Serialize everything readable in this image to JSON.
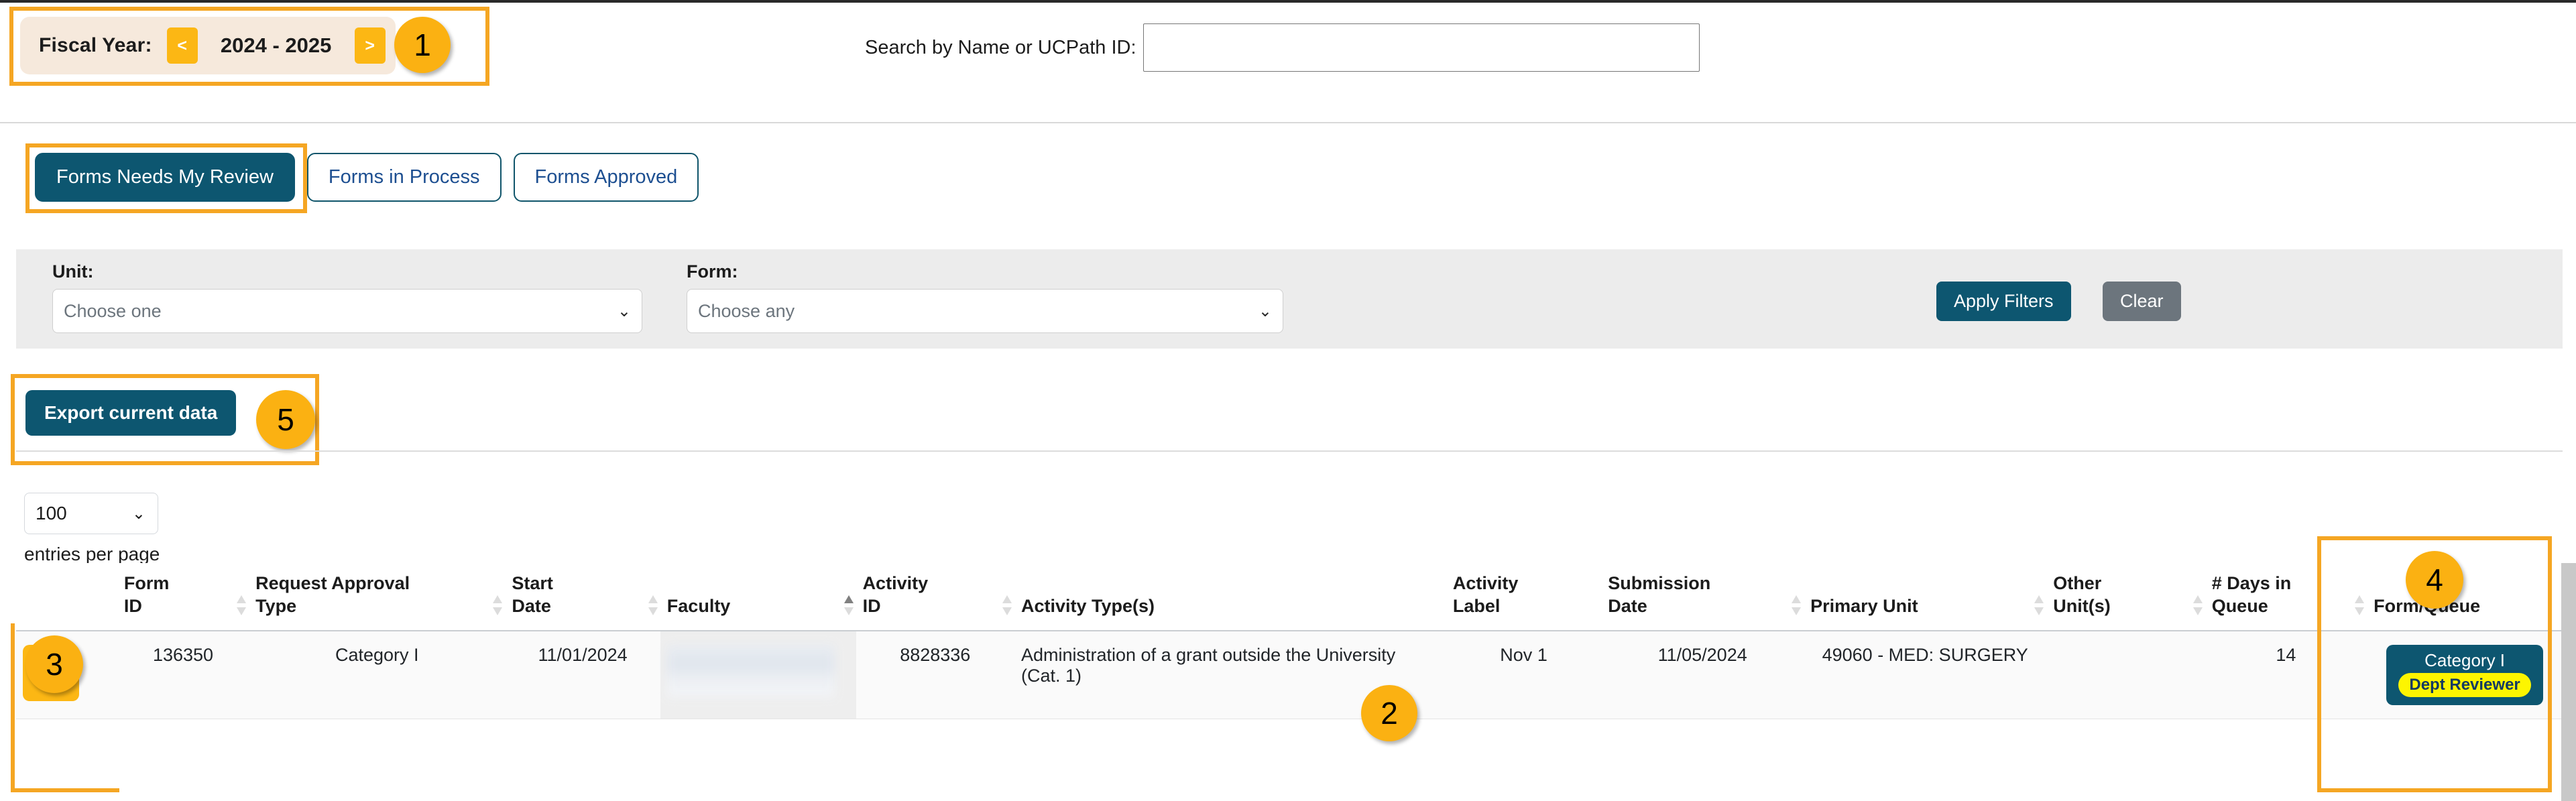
{
  "header": {
    "fiscal_year_label": "Fiscal Year:",
    "fiscal_year_prev": "<",
    "fiscal_year_value": "2024 - 2025",
    "fiscal_year_next": ">",
    "search_label": "Search by Name or UCPath ID:",
    "search_value": "",
    "search_placeholder": ""
  },
  "tabs": [
    {
      "label": "Forms Needs My Review",
      "active": true
    },
    {
      "label": "Forms in Process",
      "active": false
    },
    {
      "label": "Forms Approved",
      "active": false
    }
  ],
  "filters": {
    "unit_label": "Unit:",
    "unit_value": "Choose one",
    "form_label": "Form:",
    "form_value": "Choose any",
    "apply_label": "Apply Filters",
    "clear_label": "Clear"
  },
  "toolbar": {
    "export_label": "Export current data"
  },
  "pagination": {
    "entries_value": "100",
    "entries_text": "entries per page"
  },
  "table": {
    "columns": [
      {
        "label": "",
        "sortable": false
      },
      {
        "label": "Form ID",
        "line1": "Form",
        "line2": "ID",
        "sortable": true,
        "sorted": "none"
      },
      {
        "label": "Request Approval Type",
        "line1": "Request Approval",
        "line2": "Type",
        "sortable": true,
        "sorted": "none"
      },
      {
        "label": "Start Date",
        "line1": "Start",
        "line2": "Date",
        "sortable": true,
        "sorted": "none"
      },
      {
        "label": "Faculty",
        "line1": "",
        "line2": "Faculty",
        "sortable": true,
        "sorted": "asc"
      },
      {
        "label": "Activity ID",
        "line1": "Activity",
        "line2": "ID",
        "sortable": true,
        "sorted": "none"
      },
      {
        "label": "Activity Type(s)",
        "line1": "",
        "line2": "Activity Type(s)",
        "sortable": false,
        "sorted": "none"
      },
      {
        "label": "Activity Label",
        "line1": "Activity",
        "line2": "Label",
        "sortable": false,
        "sorted": "none"
      },
      {
        "label": "Submission Date",
        "line1": "Submission",
        "line2": "Date",
        "sortable": true,
        "sorted": "none"
      },
      {
        "label": "Primary Unit",
        "line1": "",
        "line2": "Primary Unit",
        "sortable": true,
        "sorted": "none"
      },
      {
        "label": "Other Unit(s)",
        "line1": "Other",
        "line2": "Unit(s)",
        "sortable": true,
        "sorted": "none"
      },
      {
        "label": "# Days in Queue",
        "line1": "# Days in",
        "line2": "Queue",
        "sortable": true,
        "sorted": "none"
      },
      {
        "label": "Form/Queue",
        "line1": "",
        "line2": "Form/Queue",
        "sortable": false,
        "sorted": "none"
      }
    ],
    "rows": [
      {
        "tag_count": "2",
        "form_id": "136350",
        "request_approval_type": "Category I",
        "start_date": "11/01/2024",
        "faculty": "",
        "faculty_redacted": true,
        "activity_id": "8828336",
        "activity_types": "Administration of a grant outside the University (Cat. 1)",
        "activity_label": "Nov 1",
        "submission_date": "11/05/2024",
        "primary_unit": "49060 - MED: SURGERY",
        "other_units": "",
        "days_in_queue": "14",
        "queue_form": "Category I",
        "queue_role": "Dept Reviewer"
      }
    ]
  },
  "callouts": [
    {
      "number": "1"
    },
    {
      "number": "2"
    },
    {
      "number": "3"
    },
    {
      "number": "4"
    },
    {
      "number": "5"
    }
  ],
  "colors": {
    "accent_teal": "#0d5670",
    "highlight_orange": "#f5a623",
    "badge_yellow": "#fcb714",
    "role_yellow": "#fdf500",
    "link_blue": "#1d4f91"
  }
}
